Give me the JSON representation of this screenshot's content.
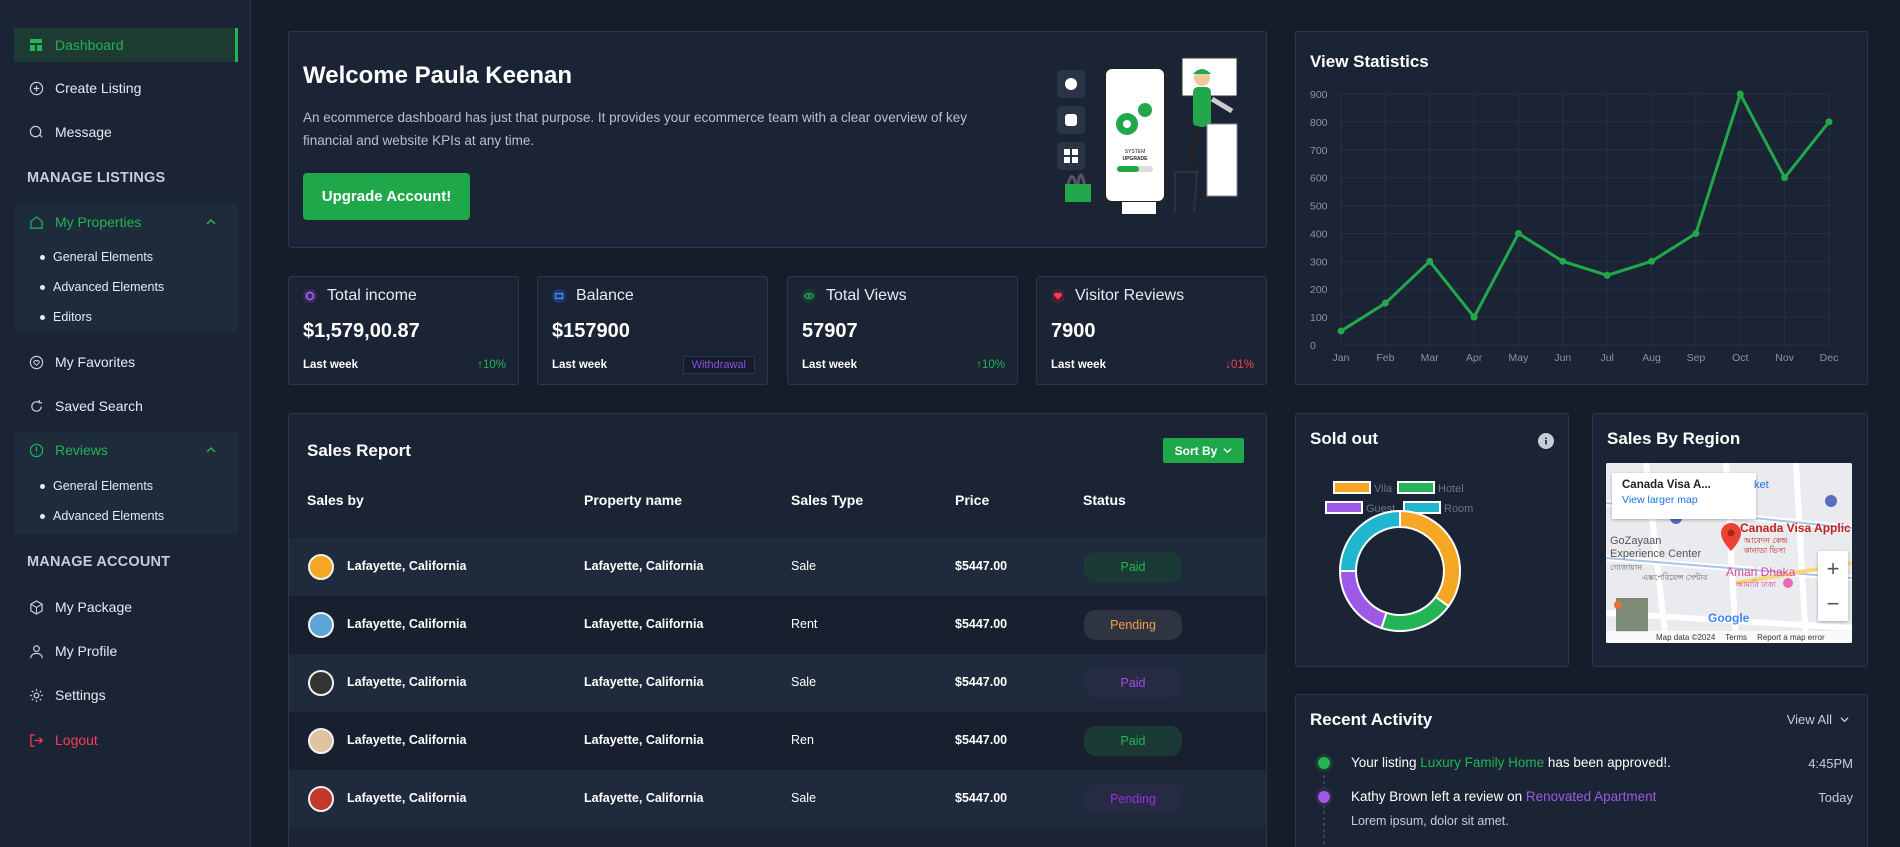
{
  "sidebar": {
    "dashboard": "Dashboard",
    "create_listing": "Create Listing",
    "message": "Message",
    "manage_listings": "MANAGE LISTINGS",
    "my_properties": "My Properties",
    "props_sub": [
      "General Elements",
      "Advanced Elements",
      "Editors"
    ],
    "my_favorites": "My Favorites",
    "saved_search": "Saved Search",
    "reviews": "Reviews",
    "reviews_sub": [
      "General Elements",
      "Advanced Elements"
    ],
    "manage_account": "MANAGE ACCOUNT",
    "my_package": "My Package",
    "my_profile": "My Profile",
    "settings": "Settings",
    "logout": "Logout"
  },
  "welcome": {
    "title": "Welcome Paula Keenan",
    "text": "An ecommerce dashboard has just that purpose. It provides your ecommerce team with a clear overview of key financial and website KPIs at any time.",
    "button": "Upgrade Account!",
    "illustration_text": [
      "SYSTEM",
      "UPGRADE"
    ]
  },
  "stats": [
    {
      "title": "Total income",
      "value": "$1,579,00.87",
      "sub": "Last week",
      "change": "↑10%",
      "color": "#22b455"
    },
    {
      "title": "Balance",
      "value": "$157900",
      "sub": "Last week",
      "badge": "Withdrawal"
    },
    {
      "title": "Total Views",
      "value": "57907",
      "sub": "Last week",
      "change": "↑10%",
      "color": "#22b455"
    },
    {
      "title": "Visitor Reviews",
      "value": "7900",
      "sub": "Last week",
      "change": "↓01%",
      "color": "#ff3b55"
    }
  ],
  "sales": {
    "title": "Sales Report",
    "sort": "Sort By",
    "headers": [
      "Sales by",
      "Property name",
      "Sales Type",
      "Price",
      "Status"
    ],
    "rows": [
      {
        "by": "Lafayette, California",
        "property": "Lafayette, California",
        "type": "Sale",
        "price": "$5447.00",
        "status": "Paid",
        "status_color": "#22b455",
        "status_bg": "#1c3a35"
      },
      {
        "by": "Lafayette, California",
        "property": "Lafayette, California",
        "type": "Rent",
        "price": "$5447.00",
        "status": "Pending",
        "status_color": "#f0a14a",
        "status_bg": "#2e3440"
      },
      {
        "by": "Lafayette, California",
        "property": "Lafayette, California",
        "type": "Sale",
        "price": "$5447.00",
        "status": "Paid",
        "status_color": "#9b4fe0",
        "status_bg": "#262a43"
      },
      {
        "by": "Lafayette, California",
        "property": "Lafayette, California",
        "type": "Ren",
        "price": "$5447.00",
        "status": "Paid",
        "status_color": "#22b455",
        "status_bg": "#1c3a35"
      },
      {
        "by": "Lafayette, California",
        "property": "Lafayette, California",
        "type": "Sale",
        "price": "$5447.00",
        "status": "Pending",
        "status_color": "#9b2fe0",
        "status_bg": "#262a43"
      }
    ]
  },
  "view_stats": {
    "title": "View Statistics"
  },
  "sold_out": {
    "title": "Sold out",
    "legend": [
      {
        "name": "Vila",
        "color": "#f5a623"
      },
      {
        "name": "Hotel",
        "color": "#22b455"
      },
      {
        "name": "Guest",
        "color": "#9b59e6"
      },
      {
        "name": "Room",
        "color": "#20b6d0"
      }
    ]
  },
  "region": {
    "title": "Sales By Region",
    "map_title": "Canada Visa A...",
    "map_link": "View larger map",
    "labels": {
      "visa": "Canada Visa Applic",
      "bn1": "আবেদন কেন্দ্র",
      "bn2": "কানাডা ভিসা",
      "gozayaan": "GoZayaan",
      "exp": "Experience Center",
      "bn3": "গোজায়ান",
      "bn4": "এক্সপেরিয়েন্স সেন্টার",
      "amari": "Amari Dhaka",
      "bn5": "আমারি ঢাকা",
      "ket": "ket",
      "google": "Google",
      "map_data": "Map data ©2024",
      "terms": "Terms",
      "report": "Report a map error",
      "zoom_in": "+",
      "zoom_out": "−"
    }
  },
  "activity": {
    "title": "Recent Activity",
    "view_all": "View All",
    "items": [
      {
        "pre": "Your listing ",
        "link": "Luxury Family Home",
        "post": " has been approved!.",
        "time": "4:45PM",
        "link_color": "#22b455",
        "dot": "#22b455"
      },
      {
        "pre": "Kathy Brown left a review on ",
        "link": "Renovated Apartment",
        "post": "",
        "time": "Today",
        "link_color": "#9b59e6",
        "dot": "#9b59e6"
      }
    ],
    "extra": "Lorem ipsum, dolor sit amet."
  },
  "chart_data": {
    "type": "line",
    "categories": [
      "Jan",
      "Feb",
      "Mar",
      "Apr",
      "May",
      "Jun",
      "Jul",
      "Aug",
      "Sep",
      "Oct",
      "Nov",
      "Dec"
    ],
    "series": [
      {
        "values": [
          50,
          150,
          300,
          100,
          400,
          300,
          250,
          300,
          400,
          900,
          600,
          800
        ]
      }
    ],
    "ylim": [
      0,
      900
    ],
    "yticks": [
      0,
      100,
      200,
      300,
      400,
      500,
      600,
      700,
      800,
      900
    ],
    "color": "#22a84a",
    "grid": true
  },
  "donut_data": {
    "type": "pie",
    "categories": [
      "Vila",
      "Hotel",
      "Guest",
      "Room"
    ],
    "values": [
      35,
      20,
      20,
      25
    ]
  }
}
